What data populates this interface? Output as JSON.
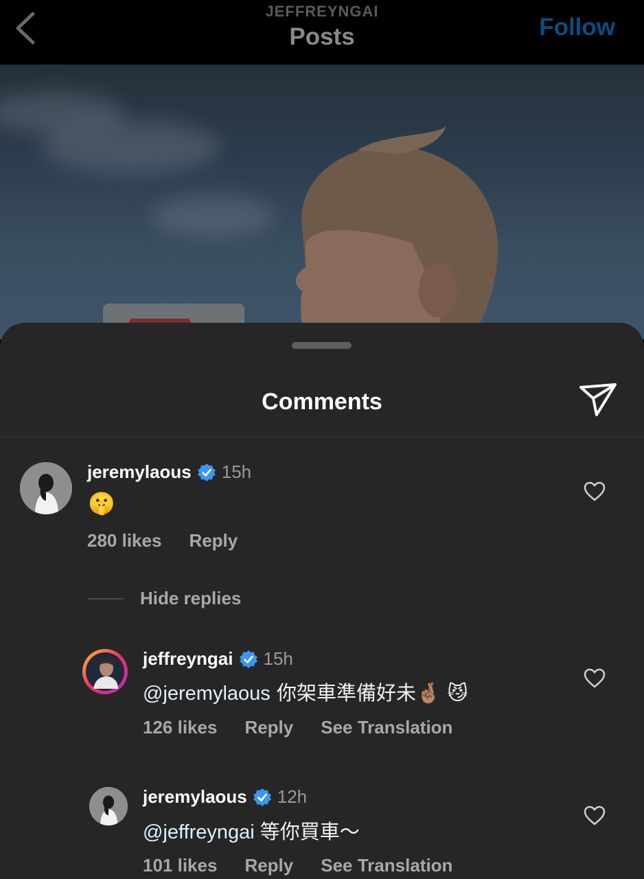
{
  "header": {
    "username": "JEFFREYNGAI",
    "title": "Posts",
    "follow_label": "Follow",
    "accent_color": "#0b4d80"
  },
  "sheet": {
    "title": "Comments"
  },
  "comments": [
    {
      "username": "jeremylaous",
      "verified": true,
      "time": "15h",
      "text": "🤫",
      "likes": "280 likes",
      "reply_label": "Reply"
    }
  ],
  "hide_replies_label": "Hide replies",
  "replies": [
    {
      "username": "jeffreyngai",
      "verified": true,
      "time": "15h",
      "mention": "@jeremylaous",
      "text": " 你架車準備好未🤞🏽 😼",
      "likes": "126 likes",
      "reply_label": "Reply",
      "translate_label": "See Translation"
    },
    {
      "username": "jeremylaous",
      "verified": true,
      "time": "12h",
      "mention": "@jeffreyngai",
      "text": " 等你買車～",
      "likes": "101 likes",
      "reply_label": "Reply",
      "translate_label": "See Translation"
    }
  ],
  "colors": {
    "verified_badge": "#3897f0",
    "sheet_background": "#262626"
  }
}
